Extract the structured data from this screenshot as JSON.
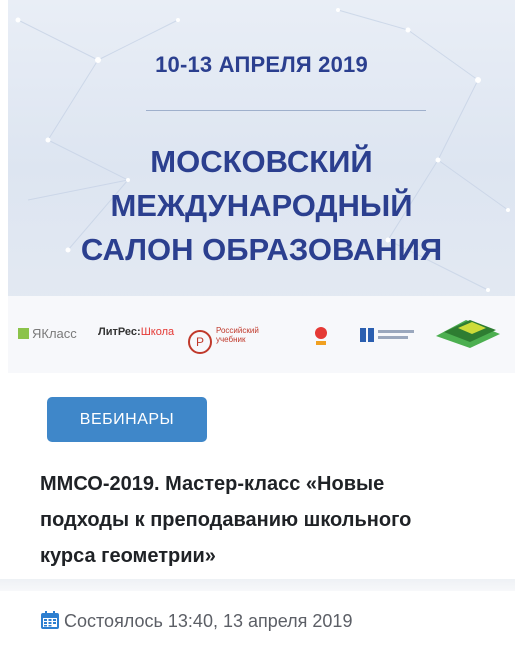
{
  "banner": {
    "date": "10-13 АПРЕЛЯ 2019",
    "title_lines": [
      "МОСКОВСКИЙ",
      "МЕЖДУНАРОДНЫЙ",
      "САЛОН ОБРАЗОВАНИЯ"
    ],
    "partners": {
      "yaklass": "ЯКласс",
      "litres_main": "ЛитРес:",
      "litres_accent": "Школа",
      "ru_textbook_line1": "Российский",
      "ru_textbook_line2": "учебник"
    }
  },
  "tag": {
    "label": "ВЕБИНАРЫ"
  },
  "headline": {
    "line1": "ММСО-2019. Мастер-класс «Новые",
    "line2": "подходы к преподаванию школьного",
    "line3": "курса геометрии»"
  },
  "status": {
    "text": "Состоялось 13:40, 13 апреля 2019"
  },
  "colors": {
    "brand_blue": "#2b3f8f",
    "tag_blue": "#3f87c9",
    "icon_blue": "#2d7fd0"
  },
  "icons": {
    "status": "calendar-icon"
  }
}
